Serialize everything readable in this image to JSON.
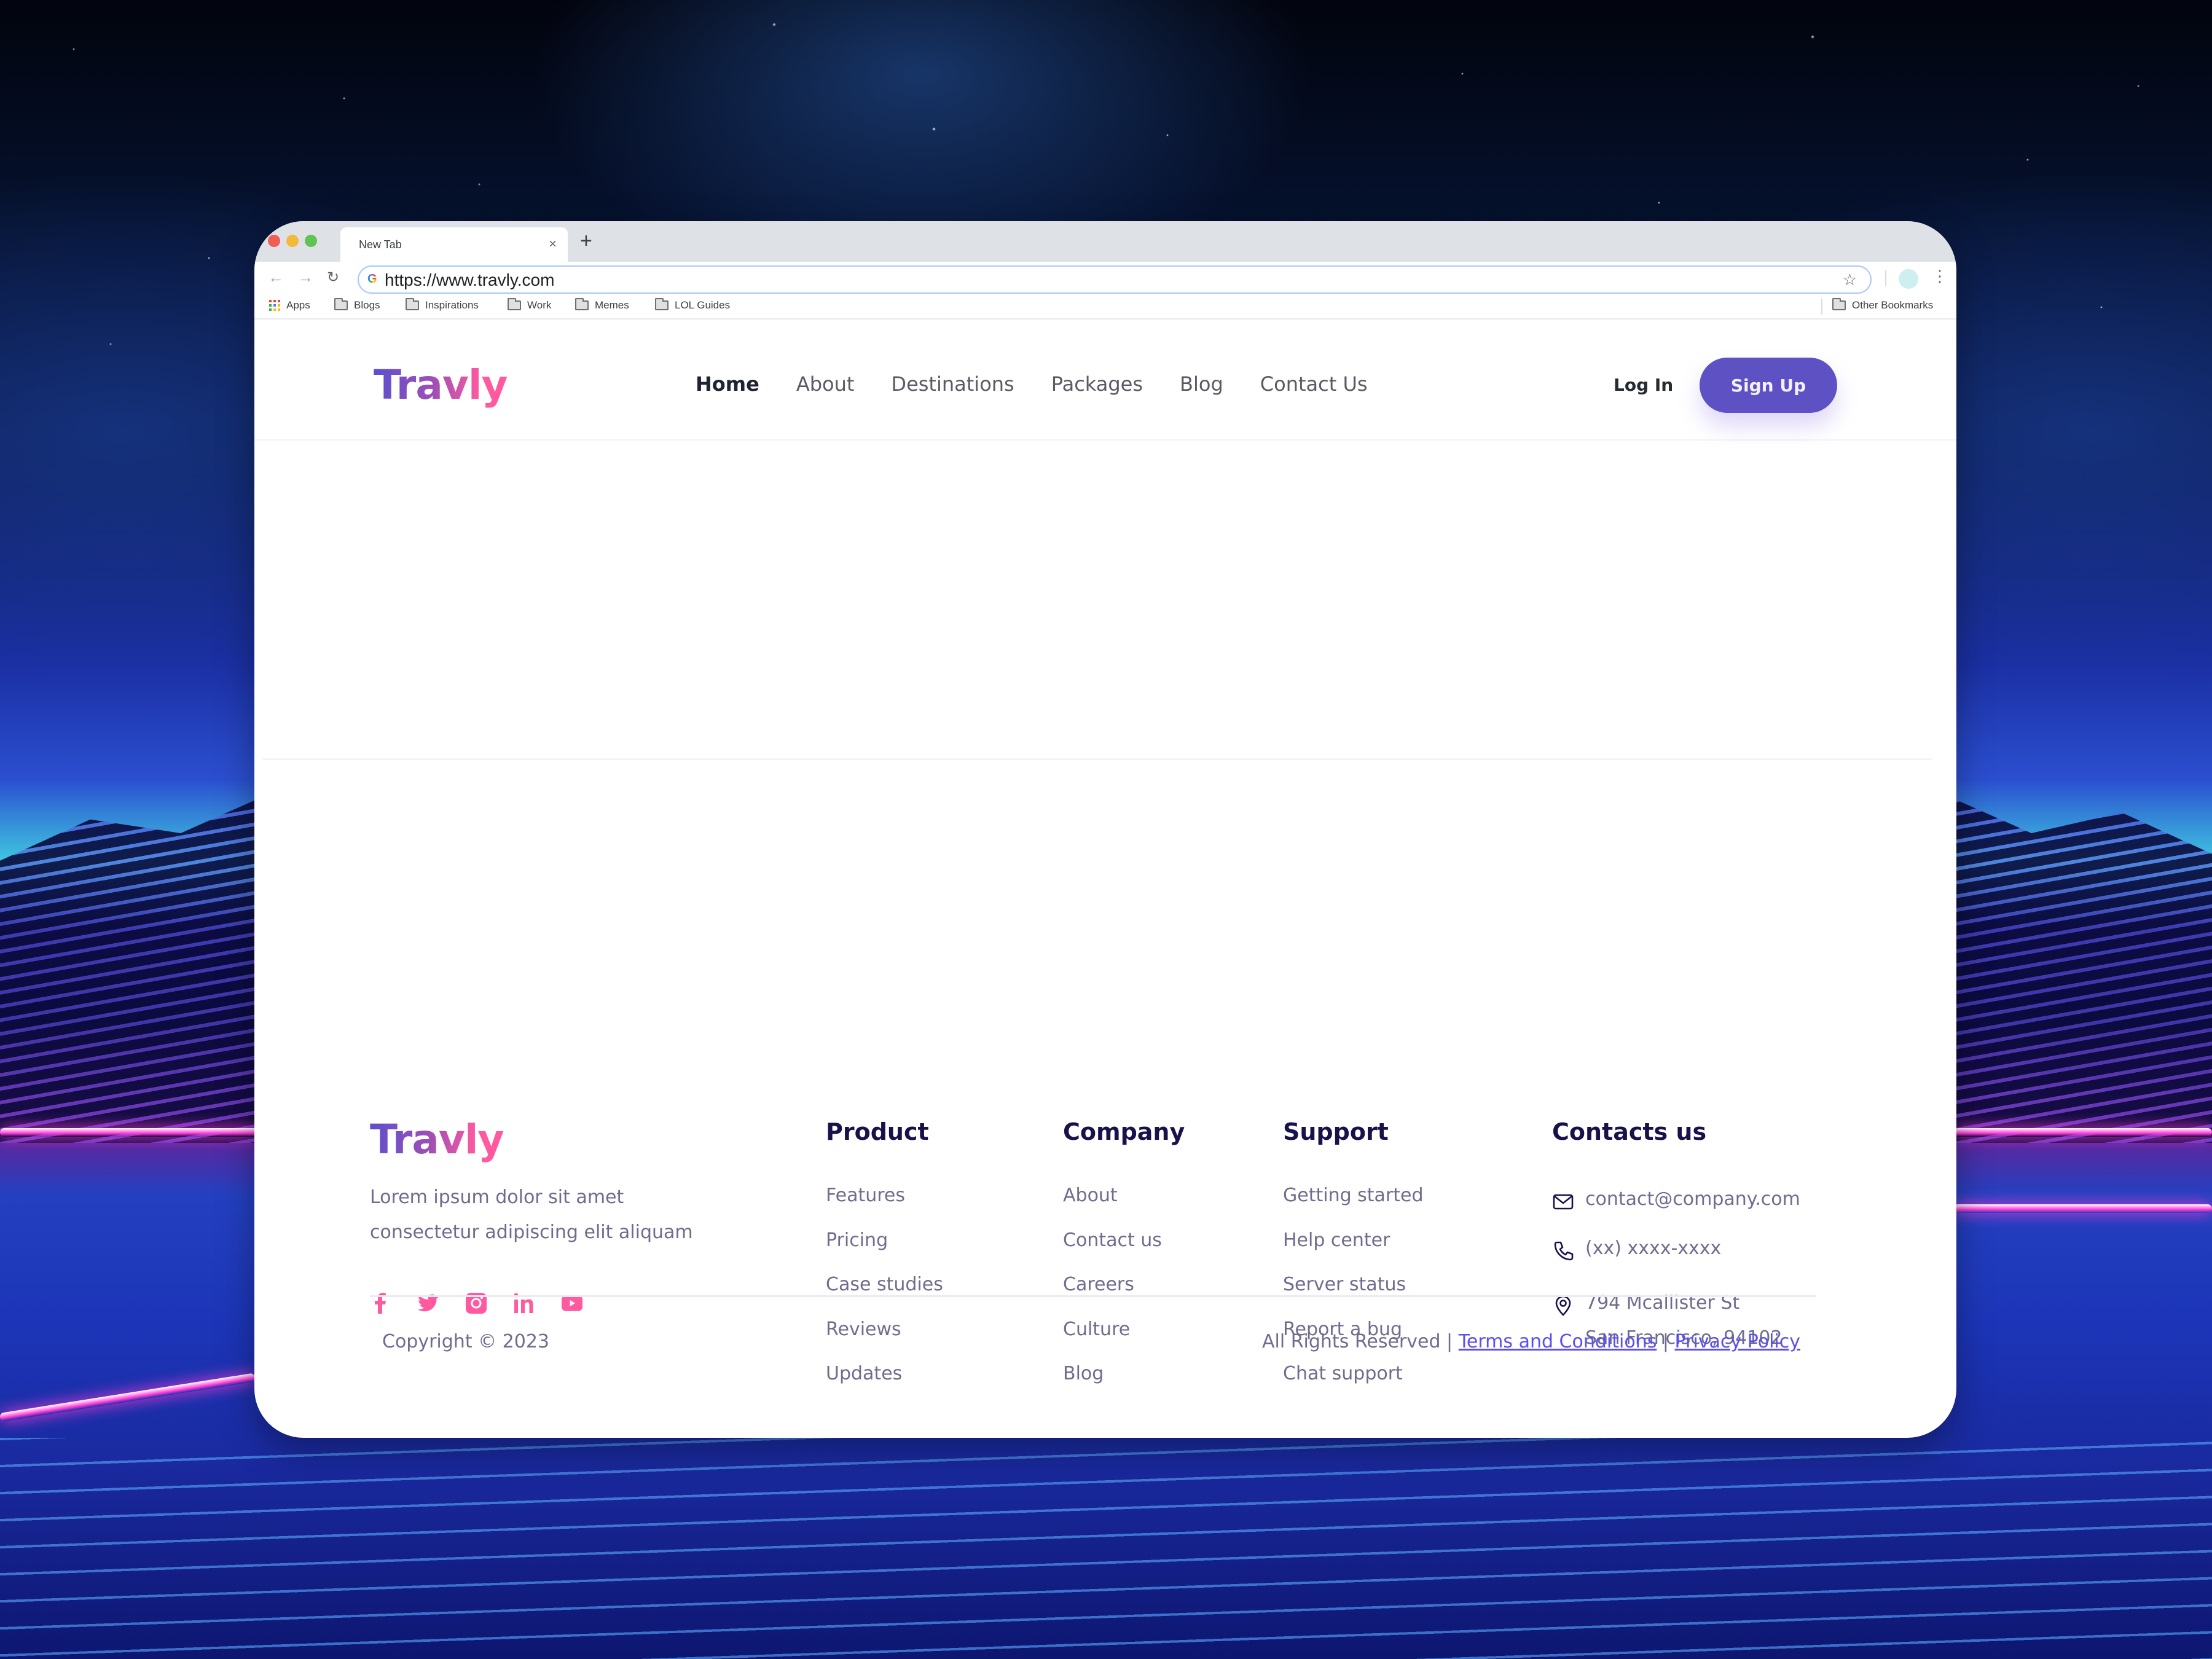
{
  "browser": {
    "tab_title": "New Tab",
    "tab_close": "×",
    "new_tab": "+",
    "url": "https://www.travly.com",
    "nav": {
      "back": "←",
      "forward": "→",
      "reload": "↻",
      "star": "☆",
      "menu": "⋮"
    },
    "bookmarks": [
      {
        "label": "Apps",
        "icon": "apps-grid-icon"
      },
      {
        "label": "Blogs",
        "icon": "folder-icon"
      },
      {
        "label": "Inspirations",
        "icon": "folder-icon"
      },
      {
        "label": "Work",
        "icon": "folder-icon"
      },
      {
        "label": "Memes",
        "icon": "folder-icon"
      },
      {
        "label": "LOL Guides",
        "icon": "folder-icon"
      }
    ],
    "other_bookmarks": "Other Bookmarks",
    "profile_color": "#cdeff0"
  },
  "site": {
    "brand": "Travly",
    "brand_gradient": [
      "#5b4fcf",
      "#ff5aa0"
    ],
    "accent": "#5d51c4",
    "link_color": "#5b4ff3",
    "nav": [
      {
        "label": "Home",
        "active": true
      },
      {
        "label": "About",
        "active": false
      },
      {
        "label": "Destinations",
        "active": false
      },
      {
        "label": "Packages",
        "active": false
      },
      {
        "label": "Blog",
        "active": false
      },
      {
        "label": "Contact Us",
        "active": false
      }
    ],
    "login_label": "Log In",
    "signup_label": "Sign Up"
  },
  "footer": {
    "brand": "Travly",
    "description": "Lorem ipsum dolor sit amet consectetur adipiscing elit aliquam",
    "socials": [
      "facebook-icon",
      "twitter-icon",
      "instagram-icon",
      "linkedin-icon",
      "youtube-icon"
    ],
    "social_color": "#ff5aa0",
    "columns": [
      {
        "title": "Product",
        "links": [
          "Features",
          "Pricing",
          "Case studies",
          "Reviews",
          "Updates"
        ]
      },
      {
        "title": "Company",
        "links": [
          "About",
          "Contact us",
          "Careers",
          "Culture",
          "Blog"
        ]
      },
      {
        "title": "Support",
        "links": [
          "Getting started",
          "Help center",
          "Server status",
          "Report a bug",
          "Chat support"
        ]
      }
    ],
    "contacts": {
      "title": "Contacts us",
      "email": "contact@company.com",
      "phone": "(xx) xxxx-xxxx",
      "address_line1": "794 Mcallister St",
      "address_line2": "San Francisco, 94102"
    },
    "copyright": "Copyright © 2023",
    "rights": "All Rights Reserved |",
    "separator": "|",
    "terms": "Terms and Conditions",
    "privacy": "Privacy Policy"
  }
}
